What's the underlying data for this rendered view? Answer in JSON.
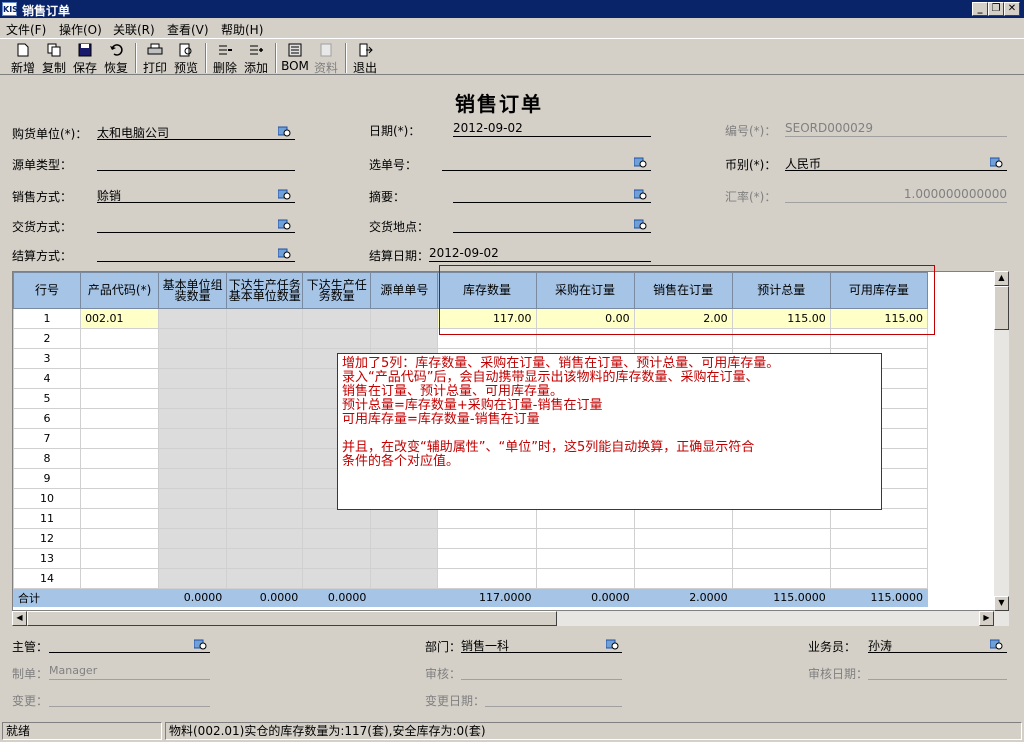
{
  "window": {
    "title": "销售订单",
    "logo": "KIS"
  },
  "menu": [
    "文件(F)",
    "操作(O)",
    "关联(R)",
    "查看(V)",
    "帮助(H)"
  ],
  "toolbar": {
    "new": "新增",
    "copy": "复制",
    "save": "保存",
    "restore": "恢复",
    "print": "打印",
    "preview": "预览",
    "delete": "删除",
    "add": "添加",
    "bom": "BOM",
    "material": "资料",
    "exit": "退出"
  },
  "form": {
    "title": "销售订单",
    "buyer_label": "购货单位(*)：",
    "buyer": "太和电脑公司",
    "date_label": "日期(*)：",
    "date": "2012-09-02",
    "number_label": "编号(*)：",
    "number": "SEORD000029",
    "source_type_label": "源单类型：",
    "source_type": "",
    "select_no_label": "选单号：",
    "select_no": "",
    "currency_label": "币别(*)：",
    "currency": "人民币",
    "sales_method_label": "销售方式：",
    "sales_method": "赊销",
    "summary_label": "摘要：",
    "summary": "",
    "rate_label": "汇率(*)：",
    "rate": "1.000000000000",
    "delivery_method_label": "交货方式：",
    "delivery_method": "",
    "delivery_place_label": "交货地点：",
    "delivery_place": "",
    "settle_method_label": "结算方式：",
    "settle_method": "",
    "settle_date_label": "结算日期：",
    "settle_date": "2012-09-02"
  },
  "grid": {
    "headers": [
      "行号",
      "产品代码(*)",
      "基本单位组装数量",
      "下达生产任务基本单位数量",
      "下达生产任务数量",
      "源单单号",
      "库存数量",
      "采购在订量",
      "销售在订量",
      "预计总量",
      "可用库存量"
    ],
    "rows": [
      [
        "1",
        "002.01",
        "",
        "",
        "",
        "",
        "117.00",
        "0.00",
        "2.00",
        "115.00",
        "115.00"
      ],
      [
        "2",
        "",
        "",
        "",
        "",
        "",
        "",
        "",
        "",
        "",
        ""
      ],
      [
        "3",
        "",
        "",
        "",
        "",
        "",
        "",
        "",
        "",
        "",
        ""
      ],
      [
        "4",
        "",
        "",
        "",
        "",
        "",
        "",
        "",
        "",
        "",
        ""
      ],
      [
        "5",
        "",
        "",
        "",
        "",
        "",
        "",
        "",
        "",
        "",
        ""
      ],
      [
        "6",
        "",
        "",
        "",
        "",
        "",
        "",
        "",
        "",
        "",
        ""
      ],
      [
        "7",
        "",
        "",
        "",
        "",
        "",
        "",
        "",
        "",
        "",
        ""
      ],
      [
        "8",
        "",
        "",
        "",
        "",
        "",
        "",
        "",
        "",
        "",
        ""
      ],
      [
        "9",
        "",
        "",
        "",
        "",
        "",
        "",
        "",
        "",
        "",
        ""
      ],
      [
        "10",
        "",
        "",
        "",
        "",
        "",
        "",
        "",
        "",
        "",
        ""
      ],
      [
        "11",
        "",
        "",
        "",
        "",
        "",
        "",
        "",
        "",
        "",
        ""
      ],
      [
        "12",
        "",
        "",
        "",
        "",
        "",
        "",
        "",
        "",
        "",
        ""
      ],
      [
        "13",
        "",
        "",
        "",
        "",
        "",
        "",
        "",
        "",
        "",
        ""
      ],
      [
        "14",
        "",
        "",
        "",
        "",
        "",
        "",
        "",
        "",
        "",
        ""
      ]
    ],
    "total": [
      "合计",
      "",
      "0.0000",
      "0.0000",
      "0.0000",
      "",
      "117.0000",
      "0.0000",
      "2.0000",
      "115.0000",
      "115.0000"
    ]
  },
  "note": {
    "lines": [
      "增加了5列：库存数量、采购在订量、销售在订量、预计总量、可用库存量。",
      "录入“产品代码”后，会自动携带显示出该物料的库存数量、采购在订量、",
      "销售在订量、预计总量、可用库存量。",
      "预计总量=库存数量+采购在订量-销售在订量",
      "可用库存量=库存数量-销售在订量",
      "",
      "并且，在改变“辅助属性”、“单位”时，这5列能自动换算，正确显示符合",
      "条件的各个对应值。"
    ]
  },
  "footer": {
    "manager_label": "主管：",
    "manager": "",
    "dept_label": "部门：",
    "dept": "销售一科",
    "salesman_label": "业务员：",
    "salesman": "孙涛",
    "maker_label": "制单：",
    "maker": "Manager",
    "audit_label": "审核：",
    "audit": "",
    "audit_date_label": "审核日期：",
    "audit_date": "",
    "changer_label": "变更：",
    "changer": "",
    "change_date_label": "变更日期：",
    "change_date": ""
  },
  "status": {
    "left": "就绪",
    "msg": "物料(002.01)实仓的库存数量为:117(套),安全库存为:0(套)"
  }
}
